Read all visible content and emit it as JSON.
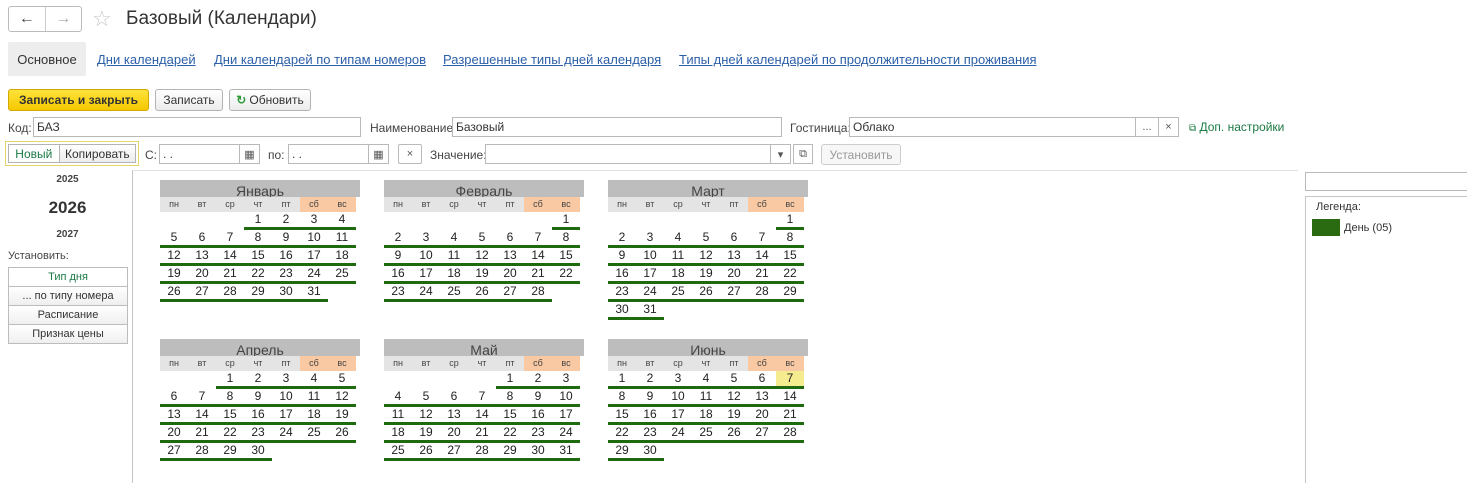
{
  "title": "Базовый (Календари)",
  "tabs": [
    "Основное",
    "Дни календарей",
    "Дни календарей по типам номеров",
    "Разрешенные типы дней календаря",
    "Типы дней календарей по продолжительности проживания"
  ],
  "toolbar": {
    "save_close": "Записать и закрыть",
    "save": "Записать",
    "refresh": "Обновить"
  },
  "form": {
    "code_label": "Код:",
    "code_value": "БАЗ",
    "name_label": "Наименование:",
    "name_value": "Базовый",
    "hotel_label": "Гостиница:",
    "hotel_value": "Облако",
    "more_settings": "Доп. настройки"
  },
  "filter": {
    "new": "Новый",
    "copy": "Копировать",
    "from_label": "С:",
    "from_value": " .  .",
    "to_label": "по:",
    "to_value": " .  .",
    "value_label": "Значение:",
    "value_value": "",
    "set_button": "Установить"
  },
  "years": {
    "prev": "2025",
    "current": "2026",
    "next": "2027"
  },
  "set_label": "Установить:",
  "set_items": [
    "Тип дня",
    "... по типу номера",
    "Расписание",
    "Признак цены"
  ],
  "weekdays": [
    "пн",
    "вт",
    "ср",
    "чт",
    "пт",
    "сб",
    "вс"
  ],
  "months": [
    {
      "name": "Январь",
      "first_weekday": 3,
      "days": 31
    },
    {
      "name": "Февраль",
      "first_weekday": 6,
      "days": 28
    },
    {
      "name": "Март",
      "first_weekday": 6,
      "days": 31
    },
    {
      "name": "Апрель",
      "first_weekday": 2,
      "days": 30
    },
    {
      "name": "Май",
      "first_weekday": 4,
      "days": 31
    },
    {
      "name": "Июнь",
      "first_weekday": 0,
      "days": 30
    }
  ],
  "highlight": {
    "month_index": 5,
    "day": 7
  },
  "legend": {
    "title": "Легенда:",
    "items": [
      {
        "label": "День (05)",
        "color": "#2a6b12"
      }
    ]
  },
  "colors": {
    "day_marker": "#1f6a0f",
    "weekend_header": "#f8c9a3",
    "today_bg": "#f5ec8f",
    "save_close_bg": "#ffd700",
    "link": "#2b5fa8",
    "green_text": "#1b7a45"
  }
}
